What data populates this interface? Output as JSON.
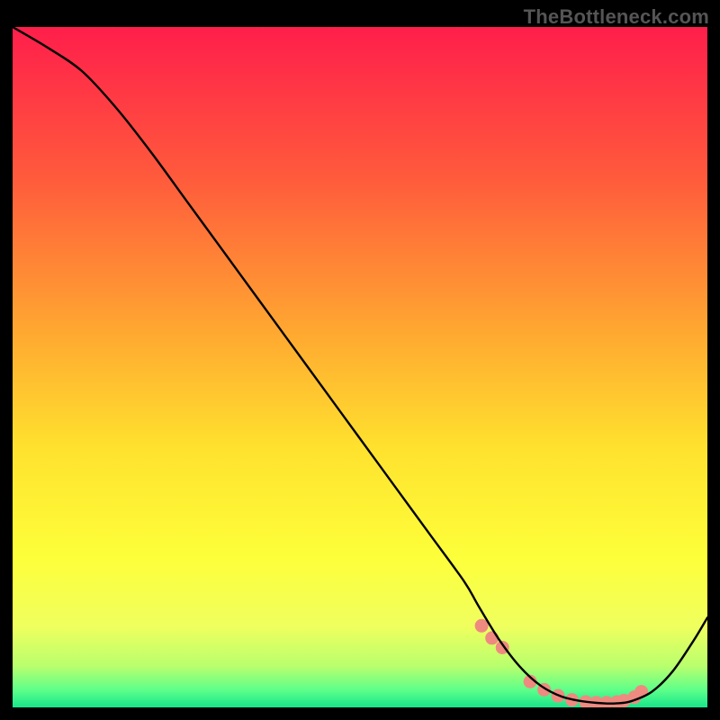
{
  "watermark": "TheBottleneck.com",
  "chart_data": {
    "type": "line",
    "title": "",
    "xlabel": "",
    "ylabel": "",
    "xlim": [
      0,
      100
    ],
    "ylim": [
      0,
      100
    ],
    "grid": false,
    "legend": false,
    "gradient_stops": [
      {
        "offset": 0.0,
        "color": "#ff1e4b"
      },
      {
        "offset": 0.22,
        "color": "#ff5a3c"
      },
      {
        "offset": 0.44,
        "color": "#ffa531"
      },
      {
        "offset": 0.62,
        "color": "#ffe22e"
      },
      {
        "offset": 0.78,
        "color": "#fdff3a"
      },
      {
        "offset": 0.88,
        "color": "#f0ff5e"
      },
      {
        "offset": 0.94,
        "color": "#b8ff6e"
      },
      {
        "offset": 0.975,
        "color": "#5cff8a"
      },
      {
        "offset": 1.0,
        "color": "#17e58b"
      }
    ],
    "series": [
      {
        "name": "bottleneck-curve",
        "x": [
          0,
          5,
          10,
          15,
          20,
          25,
          30,
          35,
          40,
          45,
          50,
          55,
          60,
          65,
          67,
          70,
          73,
          76,
          79,
          82,
          85,
          87,
          89,
          92,
          95,
          98,
          100
        ],
        "y": [
          100,
          97,
          93.5,
          88,
          81.5,
          74.5,
          67.5,
          60.5,
          53.5,
          46.5,
          39.5,
          32.5,
          25.5,
          18.5,
          15,
          10,
          6,
          3.2,
          1.6,
          0.9,
          0.6,
          0.6,
          0.9,
          2.3,
          5.3,
          9.8,
          13.2
        ]
      }
    ],
    "markers": {
      "name": "highlight-dots",
      "x": [
        67.5,
        69.0,
        70.5,
        74.5,
        76.5,
        78.5,
        80.5,
        82.5,
        84.0,
        85.5,
        87.0,
        88.0,
        89.5,
        90.5
      ],
      "y": [
        12.0,
        10.2,
        8.8,
        3.8,
        2.6,
        1.7,
        1.1,
        0.8,
        0.7,
        0.7,
        0.8,
        1.0,
        1.5,
        2.3
      ],
      "color": "#ef8a80"
    }
  }
}
